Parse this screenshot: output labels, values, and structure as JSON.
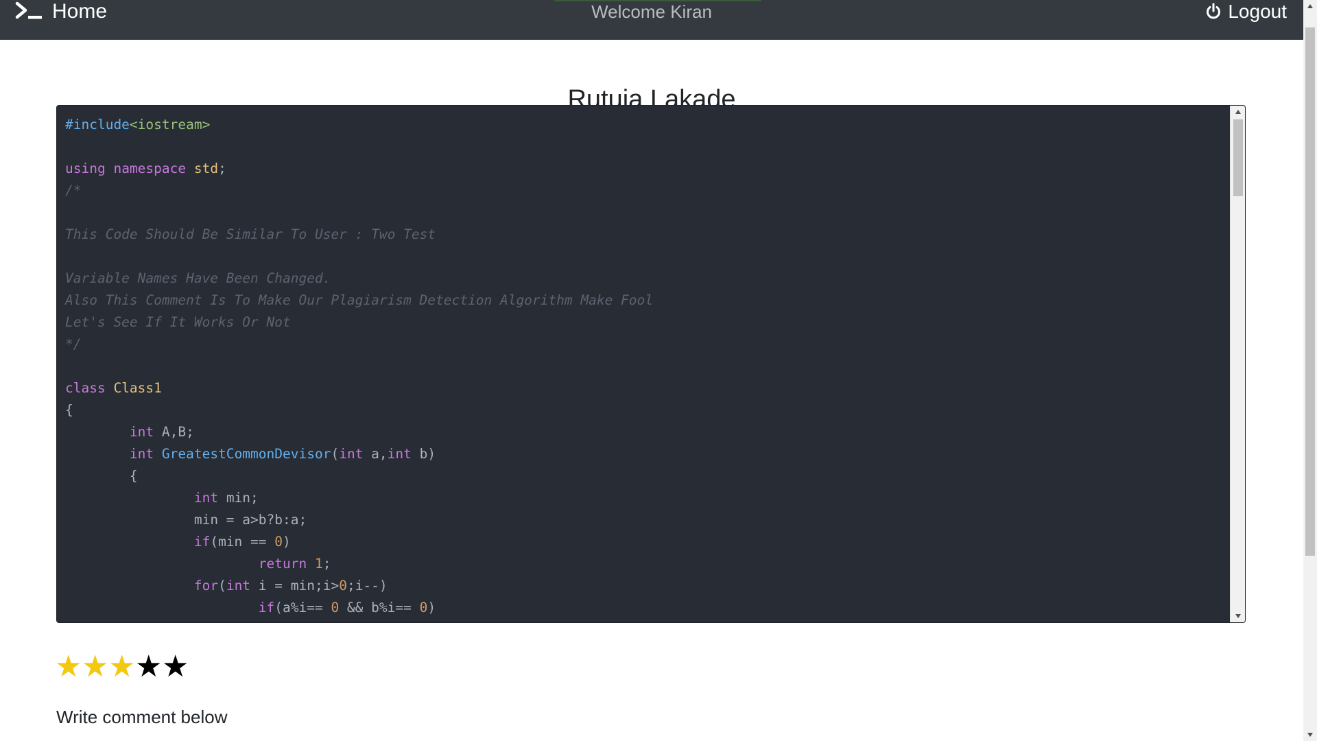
{
  "navbar": {
    "brand_label": "Home",
    "brand_icon": "terminal-icon",
    "welcome_text": "Welcome Kiran",
    "logout_label": "Logout",
    "logout_icon": "power-icon",
    "background": "#343a40"
  },
  "page": {
    "title": "Rutuja Lakade"
  },
  "code": {
    "language": "cpp",
    "theme_background": "#282c34",
    "lines": [
      [
        {
          "t": "meta",
          "v": "#include"
        },
        {
          "t": "str",
          "v": "<iostream>"
        }
      ],
      [],
      [
        {
          "t": "kw",
          "v": "using"
        },
        {
          "t": "plain",
          "v": " "
        },
        {
          "t": "kw",
          "v": "namespace"
        },
        {
          "t": "plain",
          "v": " "
        },
        {
          "t": "type",
          "v": "std"
        },
        {
          "t": "plain",
          "v": ";"
        }
      ],
      [
        {
          "t": "cmt",
          "v": "/*"
        }
      ],
      [],
      [
        {
          "t": "cmt",
          "v": "This Code Should Be Similar To User : Two Test"
        }
      ],
      [],
      [
        {
          "t": "cmt",
          "v": "Variable Names Have Been Changed."
        }
      ],
      [
        {
          "t": "cmt",
          "v": "Also This Comment Is To Make Our Plagiarism Detection Algorithm Make Fool"
        }
      ],
      [
        {
          "t": "cmt",
          "v": "Let's See If It Works Or Not"
        }
      ],
      [
        {
          "t": "cmt",
          "v": "*/"
        }
      ],
      [],
      [
        {
          "t": "kw",
          "v": "class"
        },
        {
          "t": "plain",
          "v": " "
        },
        {
          "t": "type",
          "v": "Class1"
        }
      ],
      [
        {
          "t": "plain",
          "v": "{"
        }
      ],
      [
        {
          "t": "plain",
          "v": "\t"
        },
        {
          "t": "kw",
          "v": "int"
        },
        {
          "t": "plain",
          "v": " A,B;"
        }
      ],
      [
        {
          "t": "plain",
          "v": "\t"
        },
        {
          "t": "kw",
          "v": "int"
        },
        {
          "t": "plain",
          "v": " "
        },
        {
          "t": "fn",
          "v": "GreatestCommonDevisor"
        },
        {
          "t": "plain",
          "v": "("
        },
        {
          "t": "kw",
          "v": "int"
        },
        {
          "t": "plain",
          "v": " a,"
        },
        {
          "t": "kw",
          "v": "int"
        },
        {
          "t": "plain",
          "v": " b)"
        }
      ],
      [
        {
          "t": "plain",
          "v": "\t{"
        }
      ],
      [
        {
          "t": "plain",
          "v": "\t\t"
        },
        {
          "t": "kw",
          "v": "int"
        },
        {
          "t": "plain",
          "v": " min;"
        }
      ],
      [
        {
          "t": "plain",
          "v": "\t\tmin = a>b?b:a;"
        }
      ],
      [
        {
          "t": "plain",
          "v": "\t\t"
        },
        {
          "t": "kw",
          "v": "if"
        },
        {
          "t": "plain",
          "v": "(min == "
        },
        {
          "t": "num",
          "v": "0"
        },
        {
          "t": "plain",
          "v": ")"
        }
      ],
      [
        {
          "t": "plain",
          "v": "\t\t\t"
        },
        {
          "t": "kw",
          "v": "return"
        },
        {
          "t": "plain",
          "v": " "
        },
        {
          "t": "num",
          "v": "1"
        },
        {
          "t": "plain",
          "v": ";"
        }
      ],
      [
        {
          "t": "plain",
          "v": "\t\t"
        },
        {
          "t": "kw",
          "v": "for"
        },
        {
          "t": "plain",
          "v": "("
        },
        {
          "t": "kw",
          "v": "int"
        },
        {
          "t": "plain",
          "v": " i = min;i>"
        },
        {
          "t": "num",
          "v": "0"
        },
        {
          "t": "plain",
          "v": ";i--)"
        }
      ],
      [
        {
          "t": "plain",
          "v": "\t\t\t"
        },
        {
          "t": "kw",
          "v": "if"
        },
        {
          "t": "plain",
          "v": "(a%i== "
        },
        {
          "t": "num",
          "v": "0"
        },
        {
          "t": "plain",
          "v": " && b%i== "
        },
        {
          "t": "num",
          "v": "0"
        },
        {
          "t": "plain",
          "v": ")"
        }
      ]
    ]
  },
  "rating": {
    "value": 3,
    "max": 5,
    "filled_color": "#f2c811",
    "empty_color": "#000000",
    "glyph": "★"
  },
  "comment": {
    "label": "Write comment below"
  }
}
